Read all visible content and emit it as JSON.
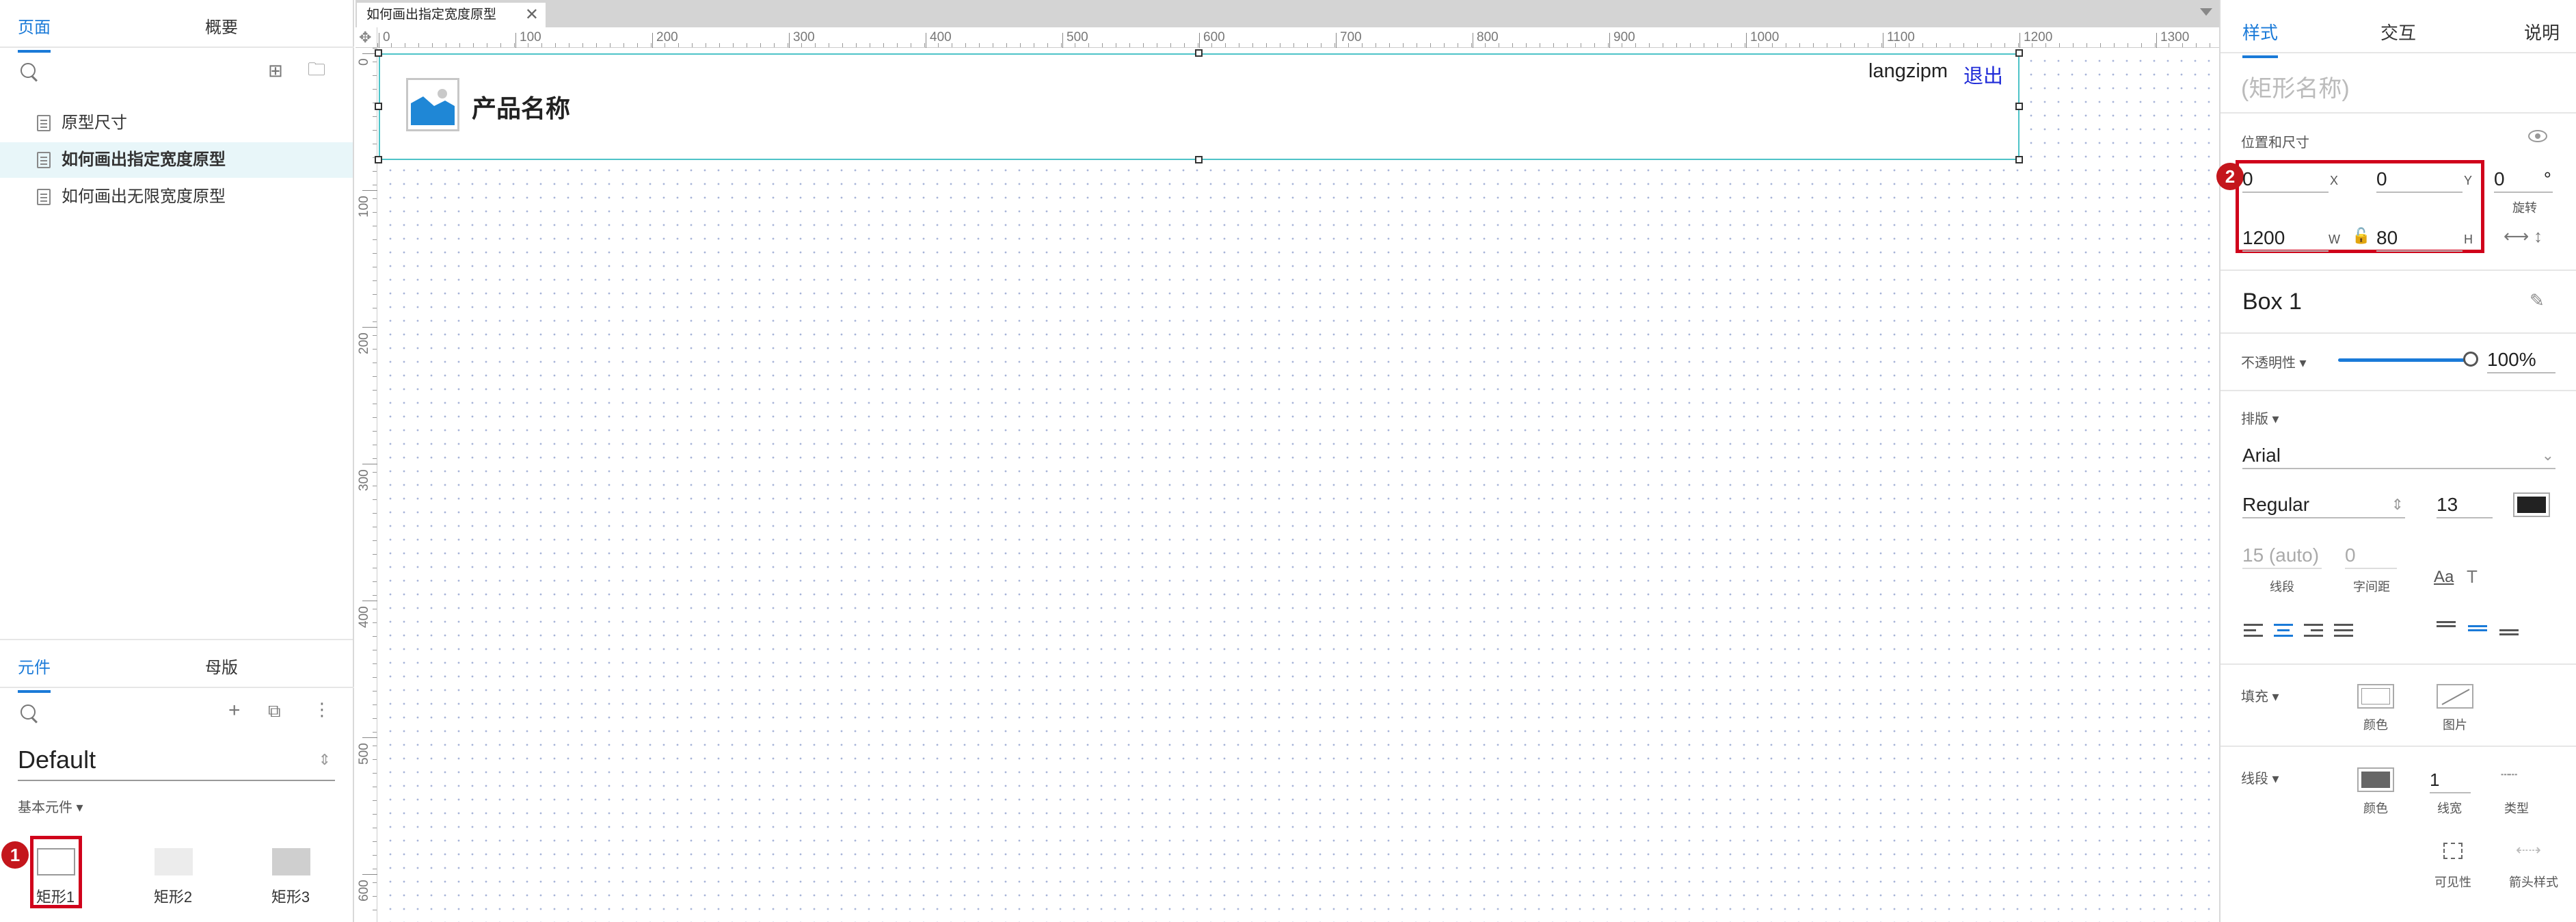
{
  "left_panel": {
    "tabs": [
      "页面",
      "概要"
    ],
    "pages": [
      "原型尺寸",
      "如何画出指定宽度原型",
      "如何画出无限宽度原型"
    ],
    "lib_tabs": [
      "元件",
      "母版"
    ],
    "library_name": "Default",
    "library_category": "基本元件 ▾",
    "widgets": [
      "矩形1",
      "矩形2",
      "矩形3"
    ],
    "badge_1": "1"
  },
  "center": {
    "doc_tab": "如何画出指定宽度原型",
    "doc_tab_close": "✕",
    "ruler_h": [
      "0",
      "100",
      "200",
      "300",
      "400",
      "500",
      "600",
      "700",
      "800",
      "900",
      "1000",
      "1100",
      "1200",
      "1300"
    ],
    "ruler_v": [
      "0",
      "100",
      "200",
      "300",
      "400",
      "500",
      "600"
    ],
    "product_name": "产品名称",
    "user_name": "langzipm",
    "logout": "退出"
  },
  "right_panel": {
    "tabs": [
      "样式",
      "交互",
      "说明"
    ],
    "shape_name_placeholder": "(矩形名称)",
    "pos_size_label": "位置和尺寸",
    "x": "0",
    "x_label": "X",
    "y": "0",
    "y_label": "Y",
    "rotation": "0",
    "rotation_unit": "°",
    "rotation_label": "旋转",
    "w": "1200",
    "w_label": "W",
    "h": "80",
    "h_label": "H",
    "badge_2": "2",
    "widget_name": "Box 1",
    "opacity_label": "不透明性 ▾",
    "opacity_value": "100%",
    "opacity_fraction": 1.0,
    "typography_label": "排版 ▾",
    "font": "Arial",
    "font_style": "Regular",
    "font_size": "13",
    "line_spacing": "15 (auto)",
    "line_spacing_label": "线段",
    "char_spacing": "0",
    "char_spacing_label": "字间距",
    "fill_label": "填充 ▾",
    "fill_color_label": "颜色",
    "fill_image_label": "图片",
    "stroke_label": "线段 ▾",
    "stroke_color_label": "颜色",
    "stroke_width": "1",
    "stroke_width_label": "线宽",
    "stroke_type_label": "类型",
    "visibility_label": "可见性",
    "arrow_label": "箭头样式"
  },
  "colors": {
    "accent": "#1a7ad8",
    "highlight": "#d0021b",
    "selection": "#4ec3c8",
    "logout_link": "#1f2bd8",
    "font_color": "#222222",
    "stroke_color": "#666666"
  }
}
